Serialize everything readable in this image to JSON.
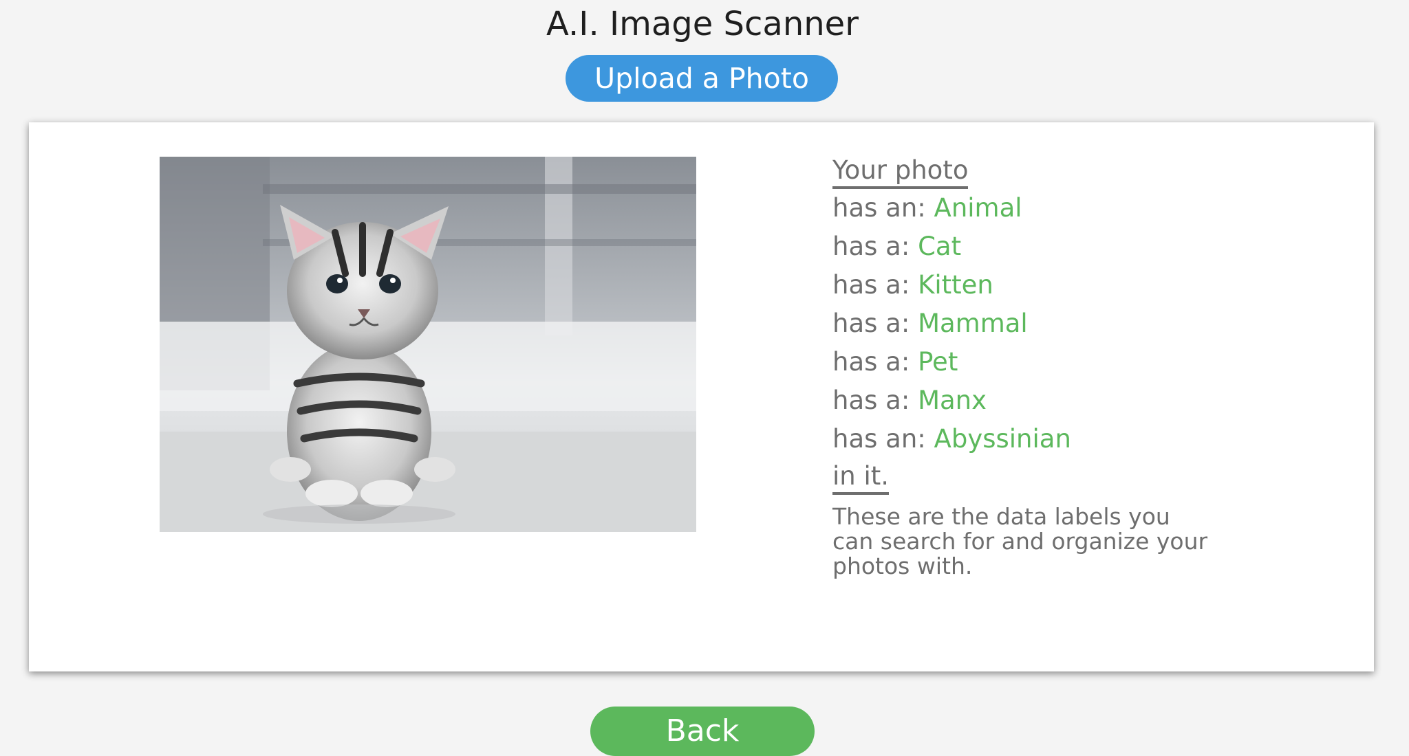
{
  "header": {
    "title": "A.I. Image Scanner",
    "upload_label": "Upload a Photo"
  },
  "result": {
    "heading": "Your photo",
    "labels": [
      {
        "prefix": "has an: ",
        "value": "Animal"
      },
      {
        "prefix": "has a: ",
        "value": "Cat"
      },
      {
        "prefix": "has a: ",
        "value": "Kitten"
      },
      {
        "prefix": "has a: ",
        "value": "Mammal"
      },
      {
        "prefix": "has a: ",
        "value": "Pet"
      },
      {
        "prefix": "has a: ",
        "value": "Manx"
      },
      {
        "prefix": "has an: ",
        "value": "Abyssinian"
      }
    ],
    "closing": "in it.",
    "explanation": "These are the data labels you can search for and organize your photos with."
  },
  "footer": {
    "back_label": "Back"
  },
  "colors": {
    "upload_button": "#3d97de",
    "label_value": "#5cb85c",
    "back_button": "#5cb85c"
  },
  "photo": {
    "icon": "kitten-photo"
  }
}
